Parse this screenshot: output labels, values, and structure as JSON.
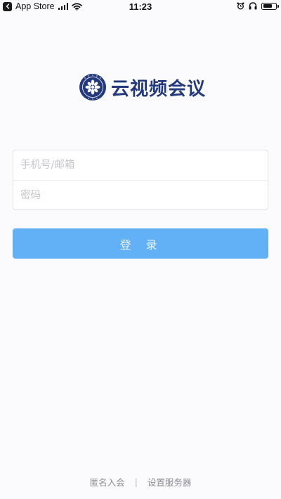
{
  "status_bar": {
    "carrier": "App Store",
    "time": "11:23",
    "battery_level": 0.7
  },
  "app": {
    "title": "云视频会议",
    "emblem_icon": "academy-emblem-icon",
    "brand_color": "#23397b"
  },
  "login_form": {
    "account_placeholder": "手机号/邮箱",
    "password_placeholder": "密码",
    "login_label": "登 录",
    "button_color": "#62b1f6"
  },
  "footer": {
    "anonymous_join": "匿名入会",
    "separator": "|",
    "server_settings": "设置服务器"
  }
}
